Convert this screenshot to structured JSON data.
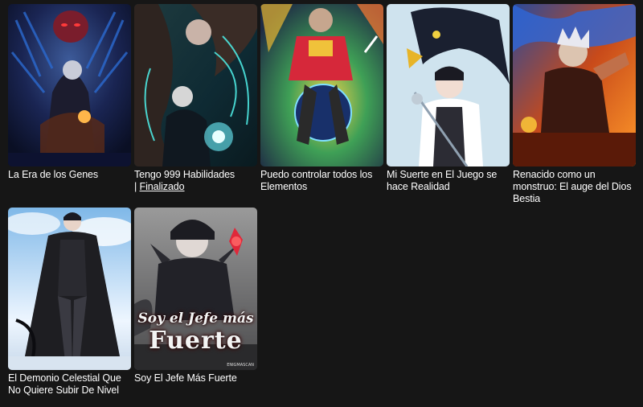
{
  "items": [
    {
      "title": "La Era de los Genes"
    },
    {
      "title": "Tengo 999 Habilidades",
      "tag_prefix": "| ",
      "tag": "Finalizado"
    },
    {
      "title": "Puedo controlar todos los Elementos"
    },
    {
      "title": "Mi Suerte en El Juego se hace Realidad"
    },
    {
      "title": "Renacido como un monstruo: El auge del Dios Bestia"
    },
    {
      "title": "El Demonio Celestial Que No Quiere Subir De Nivel"
    },
    {
      "title": "Soy El Jefe Más Fuerte",
      "cover_text_line1": "Soy el Jefe más",
      "cover_text_line2": "Fuerte",
      "cover_credit": "ENIGMASCAN"
    }
  ]
}
